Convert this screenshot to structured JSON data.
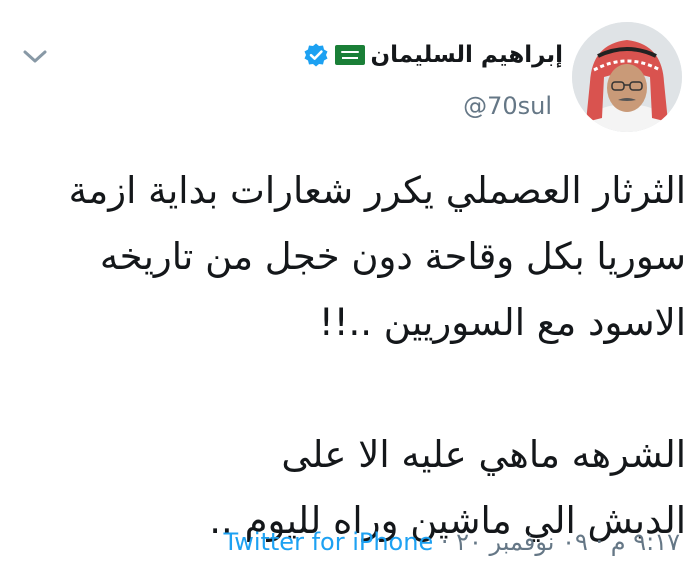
{
  "author": {
    "display_name": "إبراهيم السليمان",
    "handle": "@70sul",
    "flag_icon": "saudi-flag-icon",
    "verified_icon": "verified-badge-icon"
  },
  "tweet": {
    "lines": [
      "الثرثار العصملي يكرر شعارات بداية ازمة",
      "سوريا بكل وقاحة دون خجل من تاريخه",
      "الاسود مع السوريين ..!!",
      "",
      "الشرهه ماهي عليه الا على",
      "الدبش الي ماشين وراه لليوم .."
    ],
    "timestamp": "٩:١٧ م · ٠٩ نوفمبر ٢٠ ·",
    "source": "Twitter for iPhone"
  },
  "colors": {
    "link": "#1da1f2",
    "secondary_text": "#657786",
    "verified": "#1da1f2",
    "flag": "#1a7f37"
  }
}
